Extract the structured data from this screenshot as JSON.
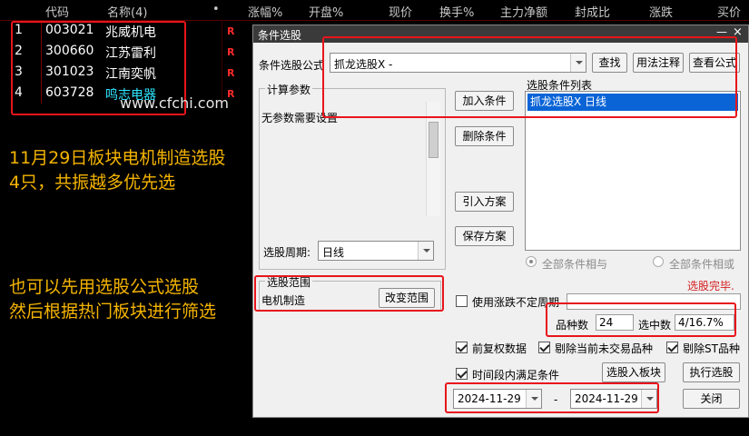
{
  "table": {
    "headers": [
      "代码",
      "名称(4)",
      "•",
      "涨幅%",
      "开盘%",
      "现价",
      "换手%",
      "主力净额",
      "封成比",
      "涨跌",
      "买价"
    ],
    "rows": [
      {
        "no": "1",
        "code": "003021",
        "name": "兆威机电",
        "flag": "R"
      },
      {
        "no": "2",
        "code": "300660",
        "name": "江苏雷利",
        "flag": "R"
      },
      {
        "no": "3",
        "code": "301023",
        "name": "江南奕帆",
        "flag": "R"
      },
      {
        "no": "4",
        "code": "603728",
        "name": "鸣志电器",
        "flag": "R"
      }
    ]
  },
  "watermark": "www.cfchi.com",
  "notes": {
    "note1": "11月29日板块电机制造选股\n4只，共振越多优先选",
    "note2": "也可以先用选股公式选股\n然后根据热门板块进行筛选"
  },
  "dialog": {
    "title": "条件选股",
    "minimize": "—",
    "close": "×",
    "formula_label": "条件选股公式",
    "formula_value": "抓龙选股X  -",
    "btn_find": "查找",
    "btn_usage": "用法注释",
    "btn_view": "查看公式",
    "params_group": "计算参数",
    "params_text": "无参数需要设置",
    "list_label": "选股条件列表",
    "list_items": [
      "抓龙选股X  日线"
    ],
    "btn_add": "加入条件",
    "btn_delete": "删除条件",
    "btn_import": "引入方案",
    "btn_save": "保存方案",
    "period_label": "选股周期:",
    "period_value": "日线",
    "radio_and": "全部条件相与",
    "radio_or": "全部条件相或",
    "scope_group": "选股范围",
    "scope_value": "电机制造",
    "btn_scope": "改变范围",
    "status": "选股完毕.",
    "use_uncertain_period": "使用涨跌不定周期",
    "count_label": "品种数",
    "count_value": "24",
    "selected_label": "选中数",
    "selected_value": "4/16.7%",
    "chk_adjust": "前复权数据",
    "chk_exclude_untraded": "剔除当前未交易品种",
    "chk_exclude_st": "剔除ST品种",
    "chk_time_range": "时间段内满足条件",
    "btn_to_block": "选股入板块",
    "btn_run": "执行选股",
    "date_from": "2024-11-29",
    "date_sep": "-",
    "date_to": "2024-11-29",
    "btn_close": "关闭"
  }
}
